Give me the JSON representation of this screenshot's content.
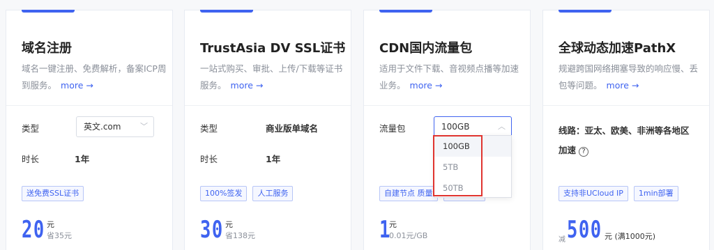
{
  "cards": [
    {
      "title": "域名注册",
      "desc": "域名一键注册、免费解析，备案ICP周到服务。",
      "more": "more →",
      "row1_label": "类型",
      "row1_select": "英文.com",
      "row2_label": "时长",
      "row2_value": "1年",
      "tags": [
        "送免费SSL证书"
      ],
      "price": "20",
      "unit": "元",
      "save": "省35元"
    },
    {
      "title": "TrustAsia DV SSL证书",
      "desc": "一站式购买、审批、上传/下载等证书服务。",
      "more": "more →",
      "row1_label": "类型",
      "row1_value": "商业版单域名",
      "row2_label": "时长",
      "row2_value": "1年",
      "tags": [
        "100%签发",
        "人工服务"
      ],
      "price": "30",
      "unit": "元",
      "save": "省138元"
    },
    {
      "title": "CDN国内流量包",
      "desc": "适用于文件下载、音视频点播等加速业务。",
      "more": "more →",
      "row1_label": "流量包",
      "row1_select": "100GB",
      "tags": [
        "自建节点 质量"
      ],
      "price": "1",
      "unit": "元",
      "save": "0.01元/GB",
      "dropdown_options": [
        "100GB",
        "5TB",
        "50TB"
      ]
    },
    {
      "title": "全球动态加速PathX",
      "desc": "规避跨国网络拥塞导致的响应慢、丢包等问题。",
      "more": "more →",
      "line_label": "线路：亚太、欧美、非洲等各地区加速",
      "help": "?",
      "tags": [
        "支持非UCloud IP",
        "1min部署"
      ],
      "prefix": "减",
      "price": "500",
      "unit": "元 (满1000元)"
    }
  ],
  "colors": {
    "accent": "#3f63f0",
    "highlight": "#e0342f"
  }
}
